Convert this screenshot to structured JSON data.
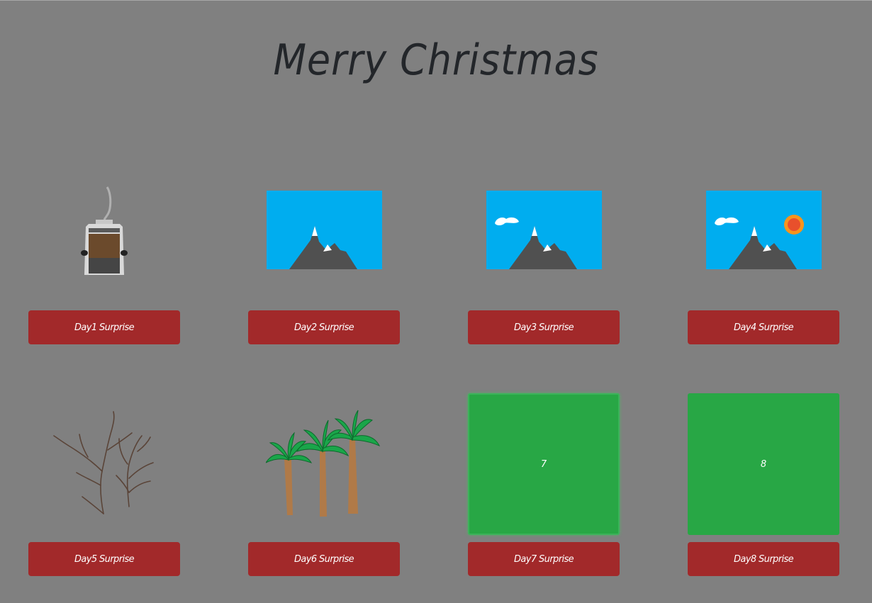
{
  "page": {
    "title": "Merry Christmas",
    "background": "#808080"
  },
  "days": [
    {
      "button_label": "Day1 Surprise",
      "image": "cable-car-icon"
    },
    {
      "button_label": "Day2 Surprise",
      "image": "mountain-scene-icon"
    },
    {
      "button_label": "Day3 Surprise",
      "image": "mountain-cloud-scene-icon"
    },
    {
      "button_label": "Day4 Surprise",
      "image": "mountain-cloud-sun-scene-icon"
    },
    {
      "button_label": "Day5 Surprise",
      "image": "bare-branches-icon"
    },
    {
      "button_label": "Day6 Surprise",
      "image": "palm-trees-icon"
    },
    {
      "button_label": "Day7 Surprise",
      "box_text": "7",
      "box_color": "#28a745"
    },
    {
      "button_label": "Day8 Surprise",
      "box_text": "8",
      "box_color": "#28a745"
    }
  ],
  "colors": {
    "button": "#a2292a",
    "sky": "#00adef",
    "mountain": "#505050"
  }
}
